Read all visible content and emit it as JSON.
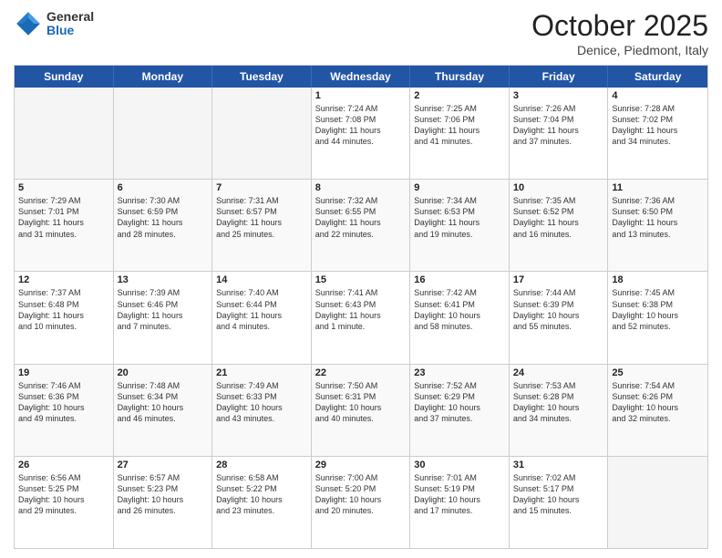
{
  "logo": {
    "general": "General",
    "blue": "Blue"
  },
  "title": "October 2025",
  "subtitle": "Denice, Piedmont, Italy",
  "days": [
    "Sunday",
    "Monday",
    "Tuesday",
    "Wednesday",
    "Thursday",
    "Friday",
    "Saturday"
  ],
  "rows": [
    [
      {
        "day": "",
        "text": "",
        "empty": true
      },
      {
        "day": "",
        "text": "",
        "empty": true
      },
      {
        "day": "",
        "text": "",
        "empty": true
      },
      {
        "day": "1",
        "text": "Sunrise: 7:24 AM\nSunset: 7:08 PM\nDaylight: 11 hours\nand 44 minutes."
      },
      {
        "day": "2",
        "text": "Sunrise: 7:25 AM\nSunset: 7:06 PM\nDaylight: 11 hours\nand 41 minutes."
      },
      {
        "day": "3",
        "text": "Sunrise: 7:26 AM\nSunset: 7:04 PM\nDaylight: 11 hours\nand 37 minutes."
      },
      {
        "day": "4",
        "text": "Sunrise: 7:28 AM\nSunset: 7:02 PM\nDaylight: 11 hours\nand 34 minutes."
      }
    ],
    [
      {
        "day": "5",
        "text": "Sunrise: 7:29 AM\nSunset: 7:01 PM\nDaylight: 11 hours\nand 31 minutes."
      },
      {
        "day": "6",
        "text": "Sunrise: 7:30 AM\nSunset: 6:59 PM\nDaylight: 11 hours\nand 28 minutes."
      },
      {
        "day": "7",
        "text": "Sunrise: 7:31 AM\nSunset: 6:57 PM\nDaylight: 11 hours\nand 25 minutes."
      },
      {
        "day": "8",
        "text": "Sunrise: 7:32 AM\nSunset: 6:55 PM\nDaylight: 11 hours\nand 22 minutes."
      },
      {
        "day": "9",
        "text": "Sunrise: 7:34 AM\nSunset: 6:53 PM\nDaylight: 11 hours\nand 19 minutes."
      },
      {
        "day": "10",
        "text": "Sunrise: 7:35 AM\nSunset: 6:52 PM\nDaylight: 11 hours\nand 16 minutes."
      },
      {
        "day": "11",
        "text": "Sunrise: 7:36 AM\nSunset: 6:50 PM\nDaylight: 11 hours\nand 13 minutes."
      }
    ],
    [
      {
        "day": "12",
        "text": "Sunrise: 7:37 AM\nSunset: 6:48 PM\nDaylight: 11 hours\nand 10 minutes."
      },
      {
        "day": "13",
        "text": "Sunrise: 7:39 AM\nSunset: 6:46 PM\nDaylight: 11 hours\nand 7 minutes."
      },
      {
        "day": "14",
        "text": "Sunrise: 7:40 AM\nSunset: 6:44 PM\nDaylight: 11 hours\nand 4 minutes."
      },
      {
        "day": "15",
        "text": "Sunrise: 7:41 AM\nSunset: 6:43 PM\nDaylight: 11 hours\nand 1 minute."
      },
      {
        "day": "16",
        "text": "Sunrise: 7:42 AM\nSunset: 6:41 PM\nDaylight: 10 hours\nand 58 minutes."
      },
      {
        "day": "17",
        "text": "Sunrise: 7:44 AM\nSunset: 6:39 PM\nDaylight: 10 hours\nand 55 minutes."
      },
      {
        "day": "18",
        "text": "Sunrise: 7:45 AM\nSunset: 6:38 PM\nDaylight: 10 hours\nand 52 minutes."
      }
    ],
    [
      {
        "day": "19",
        "text": "Sunrise: 7:46 AM\nSunset: 6:36 PM\nDaylight: 10 hours\nand 49 minutes."
      },
      {
        "day": "20",
        "text": "Sunrise: 7:48 AM\nSunset: 6:34 PM\nDaylight: 10 hours\nand 46 minutes."
      },
      {
        "day": "21",
        "text": "Sunrise: 7:49 AM\nSunset: 6:33 PM\nDaylight: 10 hours\nand 43 minutes."
      },
      {
        "day": "22",
        "text": "Sunrise: 7:50 AM\nSunset: 6:31 PM\nDaylight: 10 hours\nand 40 minutes."
      },
      {
        "day": "23",
        "text": "Sunrise: 7:52 AM\nSunset: 6:29 PM\nDaylight: 10 hours\nand 37 minutes."
      },
      {
        "day": "24",
        "text": "Sunrise: 7:53 AM\nSunset: 6:28 PM\nDaylight: 10 hours\nand 34 minutes."
      },
      {
        "day": "25",
        "text": "Sunrise: 7:54 AM\nSunset: 6:26 PM\nDaylight: 10 hours\nand 32 minutes."
      }
    ],
    [
      {
        "day": "26",
        "text": "Sunrise: 6:56 AM\nSunset: 5:25 PM\nDaylight: 10 hours\nand 29 minutes."
      },
      {
        "day": "27",
        "text": "Sunrise: 6:57 AM\nSunset: 5:23 PM\nDaylight: 10 hours\nand 26 minutes."
      },
      {
        "day": "28",
        "text": "Sunrise: 6:58 AM\nSunset: 5:22 PM\nDaylight: 10 hours\nand 23 minutes."
      },
      {
        "day": "29",
        "text": "Sunrise: 7:00 AM\nSunset: 5:20 PM\nDaylight: 10 hours\nand 20 minutes."
      },
      {
        "day": "30",
        "text": "Sunrise: 7:01 AM\nSunset: 5:19 PM\nDaylight: 10 hours\nand 17 minutes."
      },
      {
        "day": "31",
        "text": "Sunrise: 7:02 AM\nSunset: 5:17 PM\nDaylight: 10 hours\nand 15 minutes."
      },
      {
        "day": "",
        "text": "",
        "empty": true
      }
    ]
  ]
}
